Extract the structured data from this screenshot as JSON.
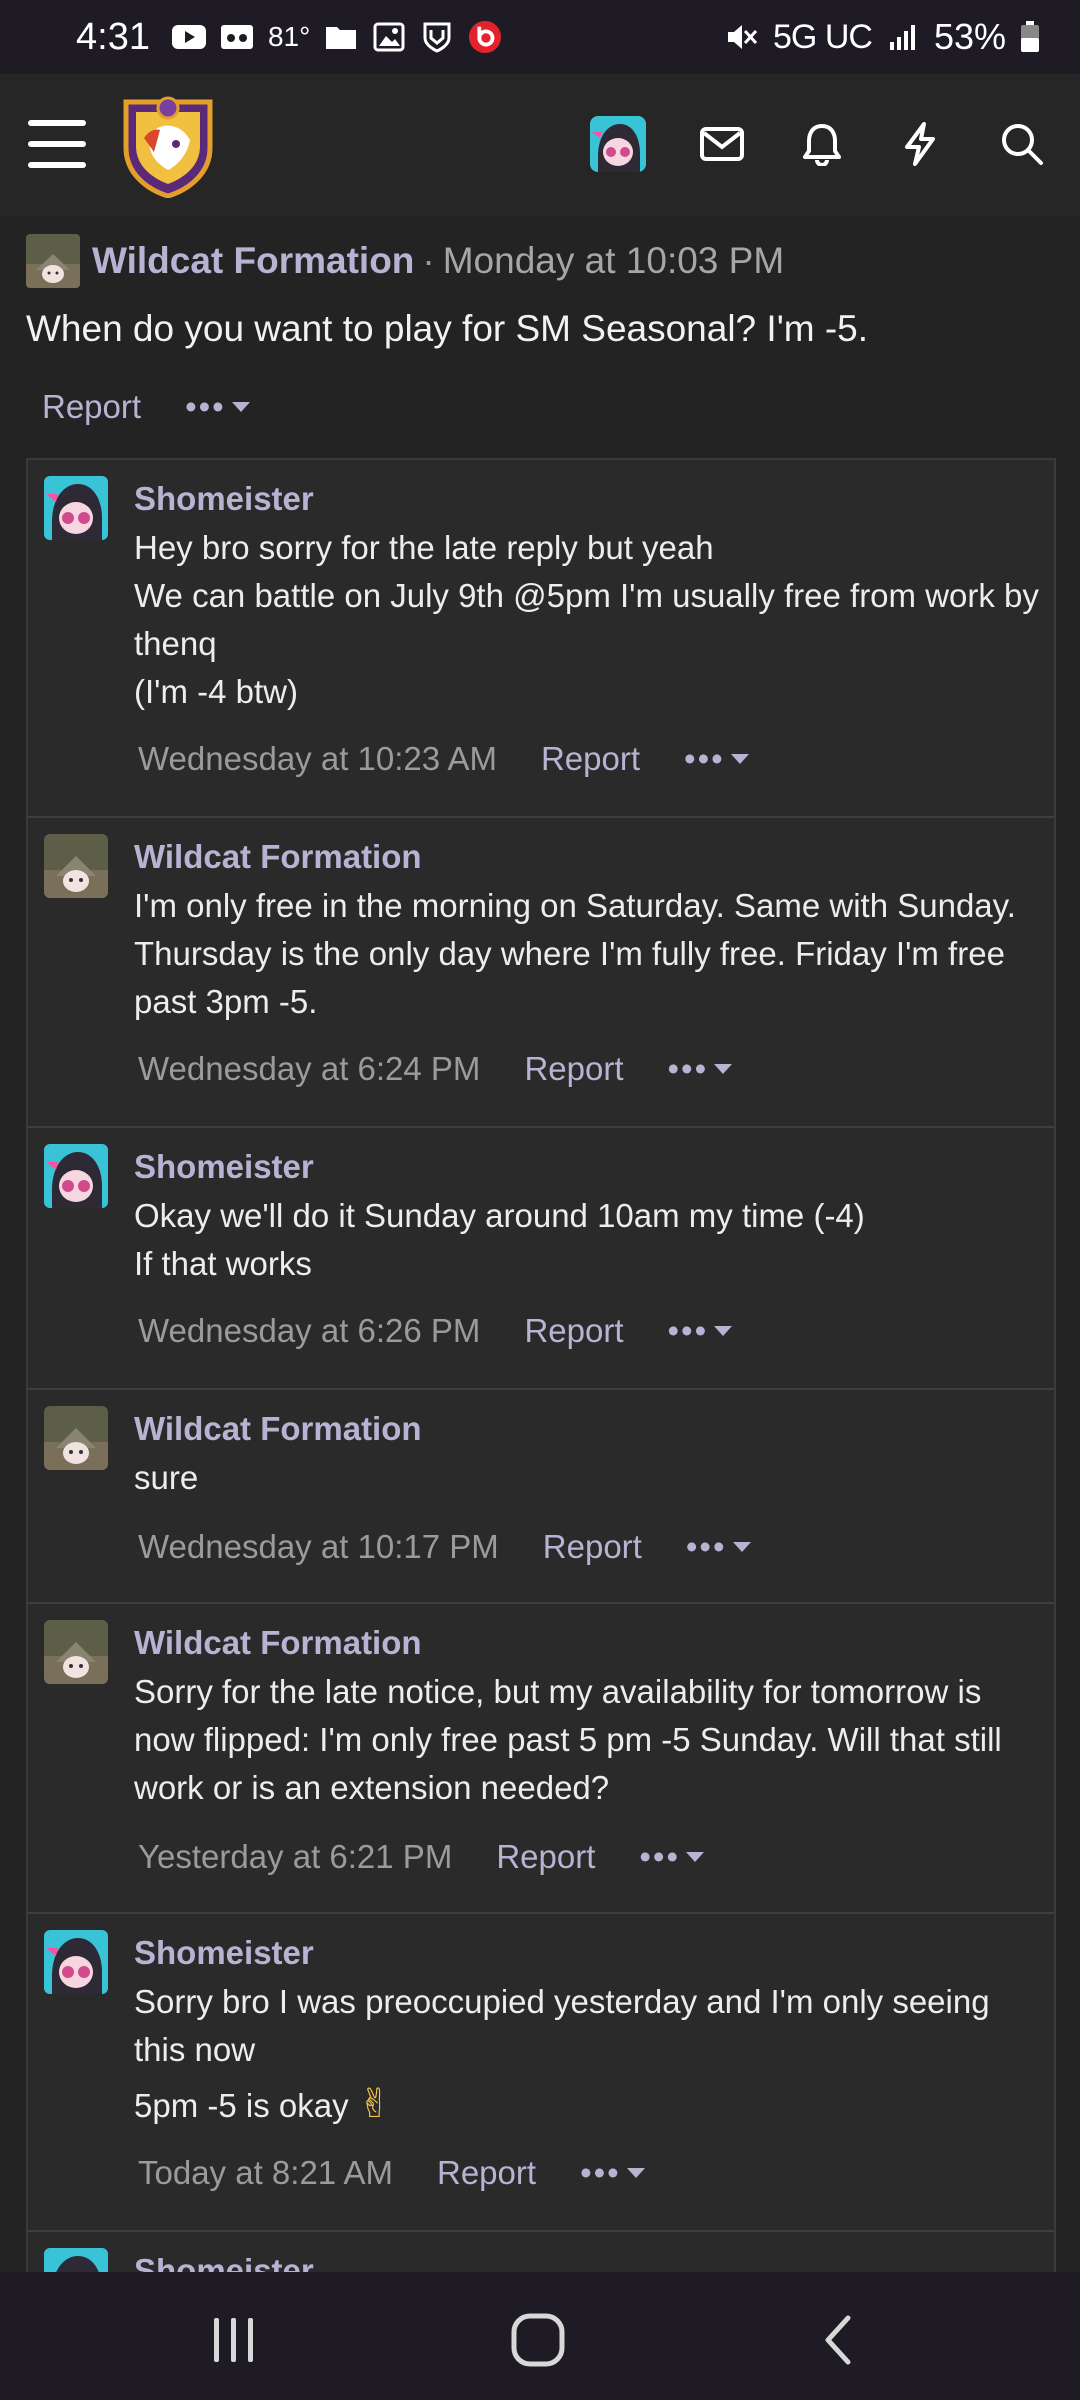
{
  "status_bar": {
    "time": "4:31",
    "temperature": "81°",
    "network": "5G UC",
    "battery": "53%"
  },
  "header": {
    "icons": [
      "menu-icon",
      "site-logo",
      "user-avatar",
      "inbox-icon",
      "bell-icon",
      "lightning-icon",
      "search-icon"
    ]
  },
  "first_post": {
    "username": "Wildcat Formation",
    "separator": "·",
    "time": "Monday at 10:03 PM",
    "text": "When do you want to play for SM Seasonal? I'm -5.",
    "report": "Report",
    "more": "•••"
  },
  "replies": [
    {
      "username": "Shomeister",
      "lines": [
        "Hey bro sorry for the late reply but yeah",
        "We can battle on July 9th @5pm I'm usually free from work by thenq",
        "(I'm -4 btw)"
      ],
      "time": "Wednesday at 10:23 AM",
      "report": "Report",
      "more": "•••"
    },
    {
      "username": "Wildcat Formation",
      "lines": [
        "I'm only free in the morning on Saturday. Same with Sunday. Thursday is the only day where I'm fully free. Friday I'm free past 3pm -5."
      ],
      "time": "Wednesday at 6:24 PM",
      "report": "Report",
      "more": "•••"
    },
    {
      "username": "Shomeister",
      "lines": [
        "Okay we'll do it Sunday around 10am my time (-4)",
        "If that works"
      ],
      "time": "Wednesday at 6:26 PM",
      "report": "Report",
      "more": "•••"
    },
    {
      "username": "Wildcat Formation",
      "lines": [
        "sure"
      ],
      "time": "Wednesday at 10:17 PM",
      "report": "Report",
      "more": "•••"
    },
    {
      "username": "Wildcat Formation",
      "lines": [
        "Sorry for the late notice, but my availability for tomorrow is now flipped: I'm only free past 5 pm -5 Sunday. Will that still work or is an extension needed?"
      ],
      "time": "Yesterday at 6:21 PM",
      "report": "Report",
      "more": "•••"
    },
    {
      "username": "Shomeister",
      "lines": [
        "Sorry bro I was preoccupied yesterday and I'm only seeing this now",
        "5pm -5 is okay"
      ],
      "emoji": "✌",
      "time": "Today at 8:21 AM",
      "report": "Report",
      "more": "•••"
    },
    {
      "username": "Shomeister",
      "lines": [],
      "time": "",
      "report": "",
      "more": ""
    }
  ],
  "nav_bar": {
    "buttons": [
      "recent-apps",
      "home",
      "back"
    ]
  }
}
